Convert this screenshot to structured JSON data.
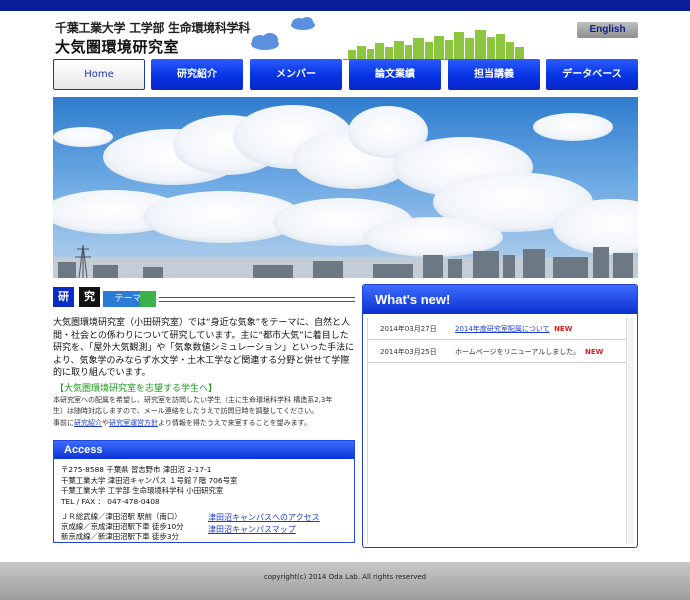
{
  "header": {
    "subtitle": "千葉工業大学 工学部 生命環境科学科",
    "site_title": "大気圏環境研究室",
    "language_link": "English"
  },
  "nav": {
    "items": [
      {
        "label": "Home",
        "active": true
      },
      {
        "label": "研究紹介",
        "active": false
      },
      {
        "label": "メンバー",
        "active": false
      },
      {
        "label": "論文業績",
        "active": false
      },
      {
        "label": "担当講義",
        "active": false
      },
      {
        "label": "データベース",
        "active": false
      }
    ]
  },
  "theme": {
    "kanji_1": "研",
    "kanji_2": "究",
    "tail_1": "テーマ"
  },
  "intro": {
    "text": "大気圏環境研究室（小田研究室）では“身近な気象”をテーマに、自然と人間・社会との係わりについて研究しています。主に“都市大気”に着目した研究を、「屋外大気観測」や「気象数値シミュレーション」といった手法により、気象学のみならず水文学・土木工学など関連する分野と併せて学際的に取り組んでいます。"
  },
  "recruit": {
    "heading": "【大気圏環境研究室を志望する学生へ】",
    "line_1": "本研究室への配属を希望し、研究室を訪問したい学生（主に生命環境科学科 構造系2,3年",
    "line_2": "生）は随時対応しますので、メール連絡をしたうえで訪問日時を調整してください。",
    "line_3_prefix": "事前に",
    "link_1": "研究紹介",
    "line_3_mid": "や",
    "link_2": "研究室運営方針",
    "line_3_suffix": "より情報を得たうえで来室することを望みます。"
  },
  "access": {
    "heading": "Access",
    "address_lines": [
      "〒275-8588 千葉県 習志野市 津田沼 2-17-1",
      "千葉工業大学 津田沼キャンパス １号館７階 706号室",
      "千葉工業大学 工学部 生命環境科学科 小田研究室",
      "TEL / FAX ： 047-478-0408"
    ],
    "routes": [
      "ＪＲ総武線／津田沼駅 駅前（南口）",
      "京成線／京成津田沼駅下車 徒歩10分",
      "新京成線／新津田沼駅下車 徒歩3分"
    ],
    "links": [
      "津田沼キャンパスへのアクセス",
      "津田沼キャンパスマップ"
    ]
  },
  "news": {
    "heading": "What's new!",
    "items": [
      {
        "date": "2014年03月27日",
        "title": "2014年度研究室配属について",
        "is_link": true,
        "badge": "NEW"
      },
      {
        "date": "2014年03月25日",
        "title": "ホームページをリニューアルしました。",
        "is_link": false,
        "badge": "NEW"
      }
    ]
  },
  "footer": {
    "copyright": "copyright(c) 2014 Oda Lab. All rights reserved"
  },
  "colors": {
    "brand_blue": "#0633e3",
    "top_strip": "#0a1e9a",
    "new_badge": "#e31b1b",
    "recruit_heading": "#1a9a1a"
  }
}
